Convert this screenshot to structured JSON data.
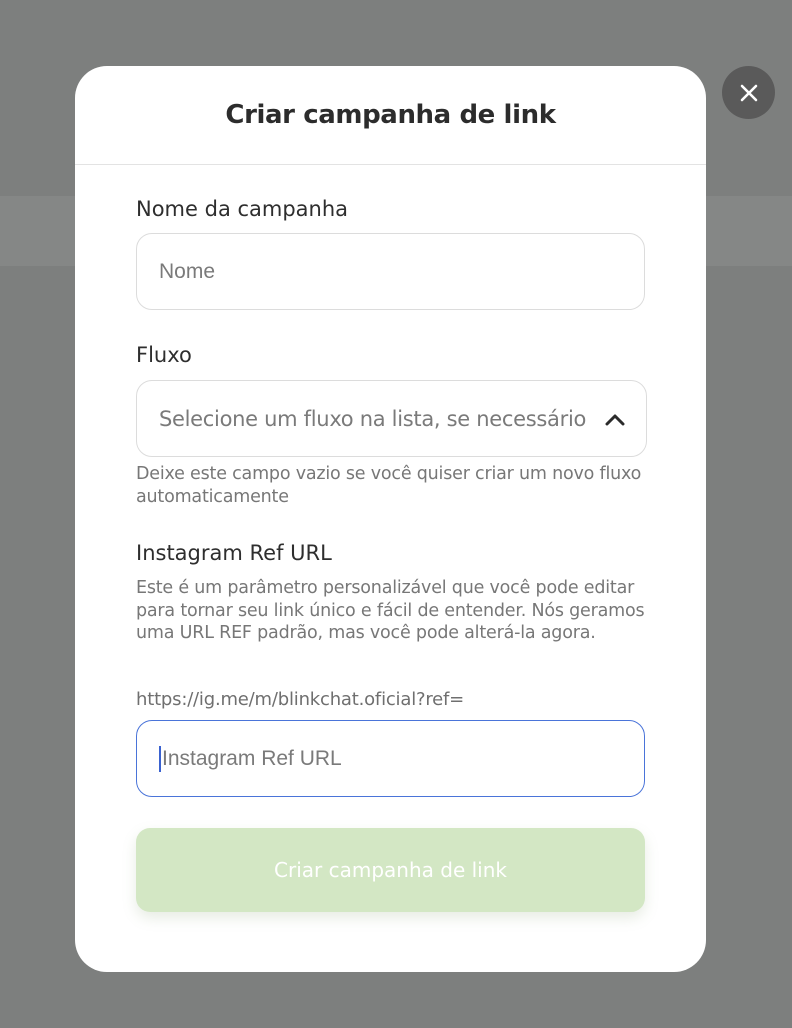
{
  "background": {
    "partial_text_1": "•••",
    "partial_text_2": "••• •••"
  },
  "modal": {
    "title": "Criar campanha de link",
    "close_icon": "close-icon",
    "campaign_name": {
      "label": "Nome da campanha",
      "placeholder": "Nome",
      "value": ""
    },
    "flow": {
      "label": "Fluxo",
      "placeholder": "Selecione um fluxo na lista, se necessário",
      "chevron_icon": "chevron-up-icon",
      "help": "Deixe este campo vazio se você quiser criar um novo fluxo automaticamente"
    },
    "ref_url": {
      "label": "Instagram Ref URL",
      "description": "Este é um parâmetro personalizável que você pode editar para tornar seu link único e fácil de entender. Nós geramos uma URL REF padrão, mas você pode alterá-la agora.",
      "prefix": "https://ig.me/m/blinkchat.oficial?ref=",
      "placeholder": "Instagram Ref URL",
      "value": ""
    },
    "submit_label": "Criar campanha de link"
  },
  "colors": {
    "overlay": "#7d7f7e",
    "submit_disabled": "#d3e7c4",
    "focus_border": "#4a74d9"
  }
}
